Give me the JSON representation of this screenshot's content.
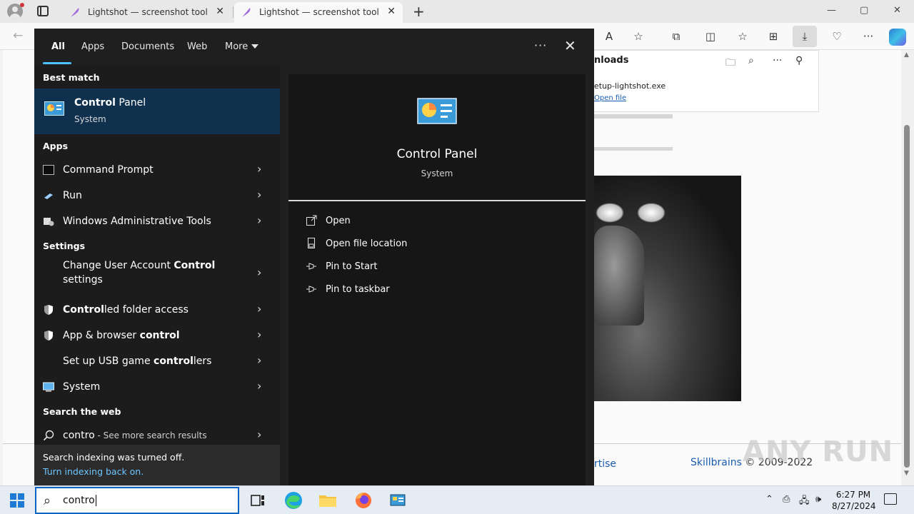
{
  "browser": {
    "tabs": [
      {
        "title": "Lightshot — screenshot tool for Mac & Win"
      },
      {
        "title": "Lightshot — screenshot tool for Mac & Win"
      }
    ],
    "close_glyph": "✕",
    "new_tab_glyph": "+",
    "window_controls": {
      "minimize": "—",
      "maximize": "▢",
      "close": "✕"
    },
    "toolbar_icons": [
      "read-aloud-icon",
      "favorite-star-icon",
      "extensions-icon",
      "split-screen-icon",
      "favorites-icon",
      "collections-icon",
      "downloads-icon",
      "browser-essentials-icon",
      "more-icon",
      "copilot-icon"
    ]
  },
  "downloads": {
    "title": "nloads",
    "file_name": "etup-lightshot.exe",
    "open_link": "Open file"
  },
  "page": {
    "footer_link": "rtise",
    "footer_brand": "Skillbrains",
    "footer_copy": " © 2009-2022",
    "watermark": "ANY RUN"
  },
  "search": {
    "tabs": [
      "All",
      "Apps",
      "Documents",
      "Web",
      "More"
    ],
    "active_tab": "All",
    "more_dots": "···",
    "close_glyph": "✕",
    "best_match_label": "Best match",
    "best_match": {
      "name_bold": "Control",
      "name_rest": " Panel",
      "subtitle": "System"
    },
    "apps_label": "Apps",
    "apps": [
      {
        "pre": "",
        "bold": "",
        "post": "Command Prompt"
      },
      {
        "pre": "",
        "bold": "",
        "post": "Run"
      },
      {
        "pre": "",
        "bold": "",
        "post": "Windows Administrative Tools"
      }
    ],
    "settings_label": "Settings",
    "settings": [
      {
        "pre": "Change User Account ",
        "bold": "Control",
        "post": " settings"
      },
      {
        "pre": "",
        "bold": "Control",
        "post": "led folder access"
      },
      {
        "pre": "App & browser ",
        "bold": "control",
        "post": ""
      },
      {
        "pre": "Set up USB game ",
        "bold": "control",
        "post": "lers"
      },
      {
        "pre": "",
        "bold": "",
        "post": "System"
      }
    ],
    "web_label": "Search the web",
    "web": {
      "query": "contro",
      "more": " - See more search results"
    },
    "footer": {
      "line1": "Search indexing was turned off.",
      "line2": "Turn indexing back on."
    },
    "chevron": "›",
    "preview": {
      "name": "Control Panel",
      "subtitle": "System",
      "actions": [
        "Open",
        "Open file location",
        "Pin to Start",
        "Pin to taskbar"
      ]
    }
  },
  "taskbar": {
    "search_text": "contro",
    "time": "6:27 PM",
    "date": "8/27/2024",
    "tray_icons": [
      "chevron-up-icon",
      "meet-now-icon",
      "network-icon",
      "volume-icon"
    ]
  },
  "colors": {
    "accent": "#4cc2ff",
    "best_match_bg": "#10314e",
    "taskbar_accent": "#0a64c4"
  }
}
